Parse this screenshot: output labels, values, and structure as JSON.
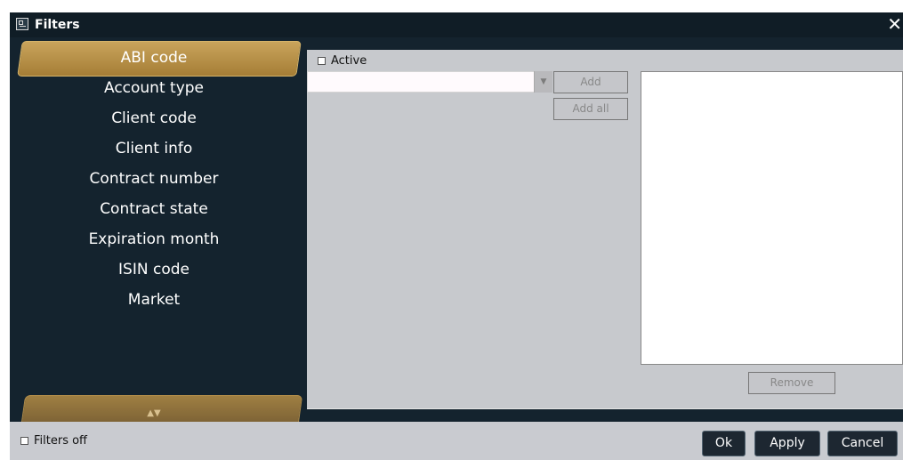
{
  "window": {
    "title": "Filters"
  },
  "sidebar": {
    "items": [
      {
        "label": "ABI code",
        "active": true
      },
      {
        "label": "Account type"
      },
      {
        "label": "Client code"
      },
      {
        "label": "Client info"
      },
      {
        "label": "Contract number"
      },
      {
        "label": "Contract state"
      },
      {
        "label": "Expiration month"
      },
      {
        "label": "ISIN code"
      },
      {
        "label": "Market"
      }
    ],
    "scroll_arrows": "▲▼"
  },
  "filter_panel": {
    "active_label": "Active",
    "select_value": "",
    "buttons": {
      "add": "Add",
      "add_all": "Add all",
      "remove": "Remove"
    }
  },
  "footer": {
    "filters_off_label": "Filters off",
    "buttons": {
      "ok": "Ok",
      "apply": "Apply",
      "cancel": "Cancel"
    }
  },
  "colors": {
    "sidebar_bg": "#14232e",
    "accent_gold": "#b8964d",
    "panel_bg": "#c7c9cd",
    "footer_bg": "#c9cbd0"
  }
}
